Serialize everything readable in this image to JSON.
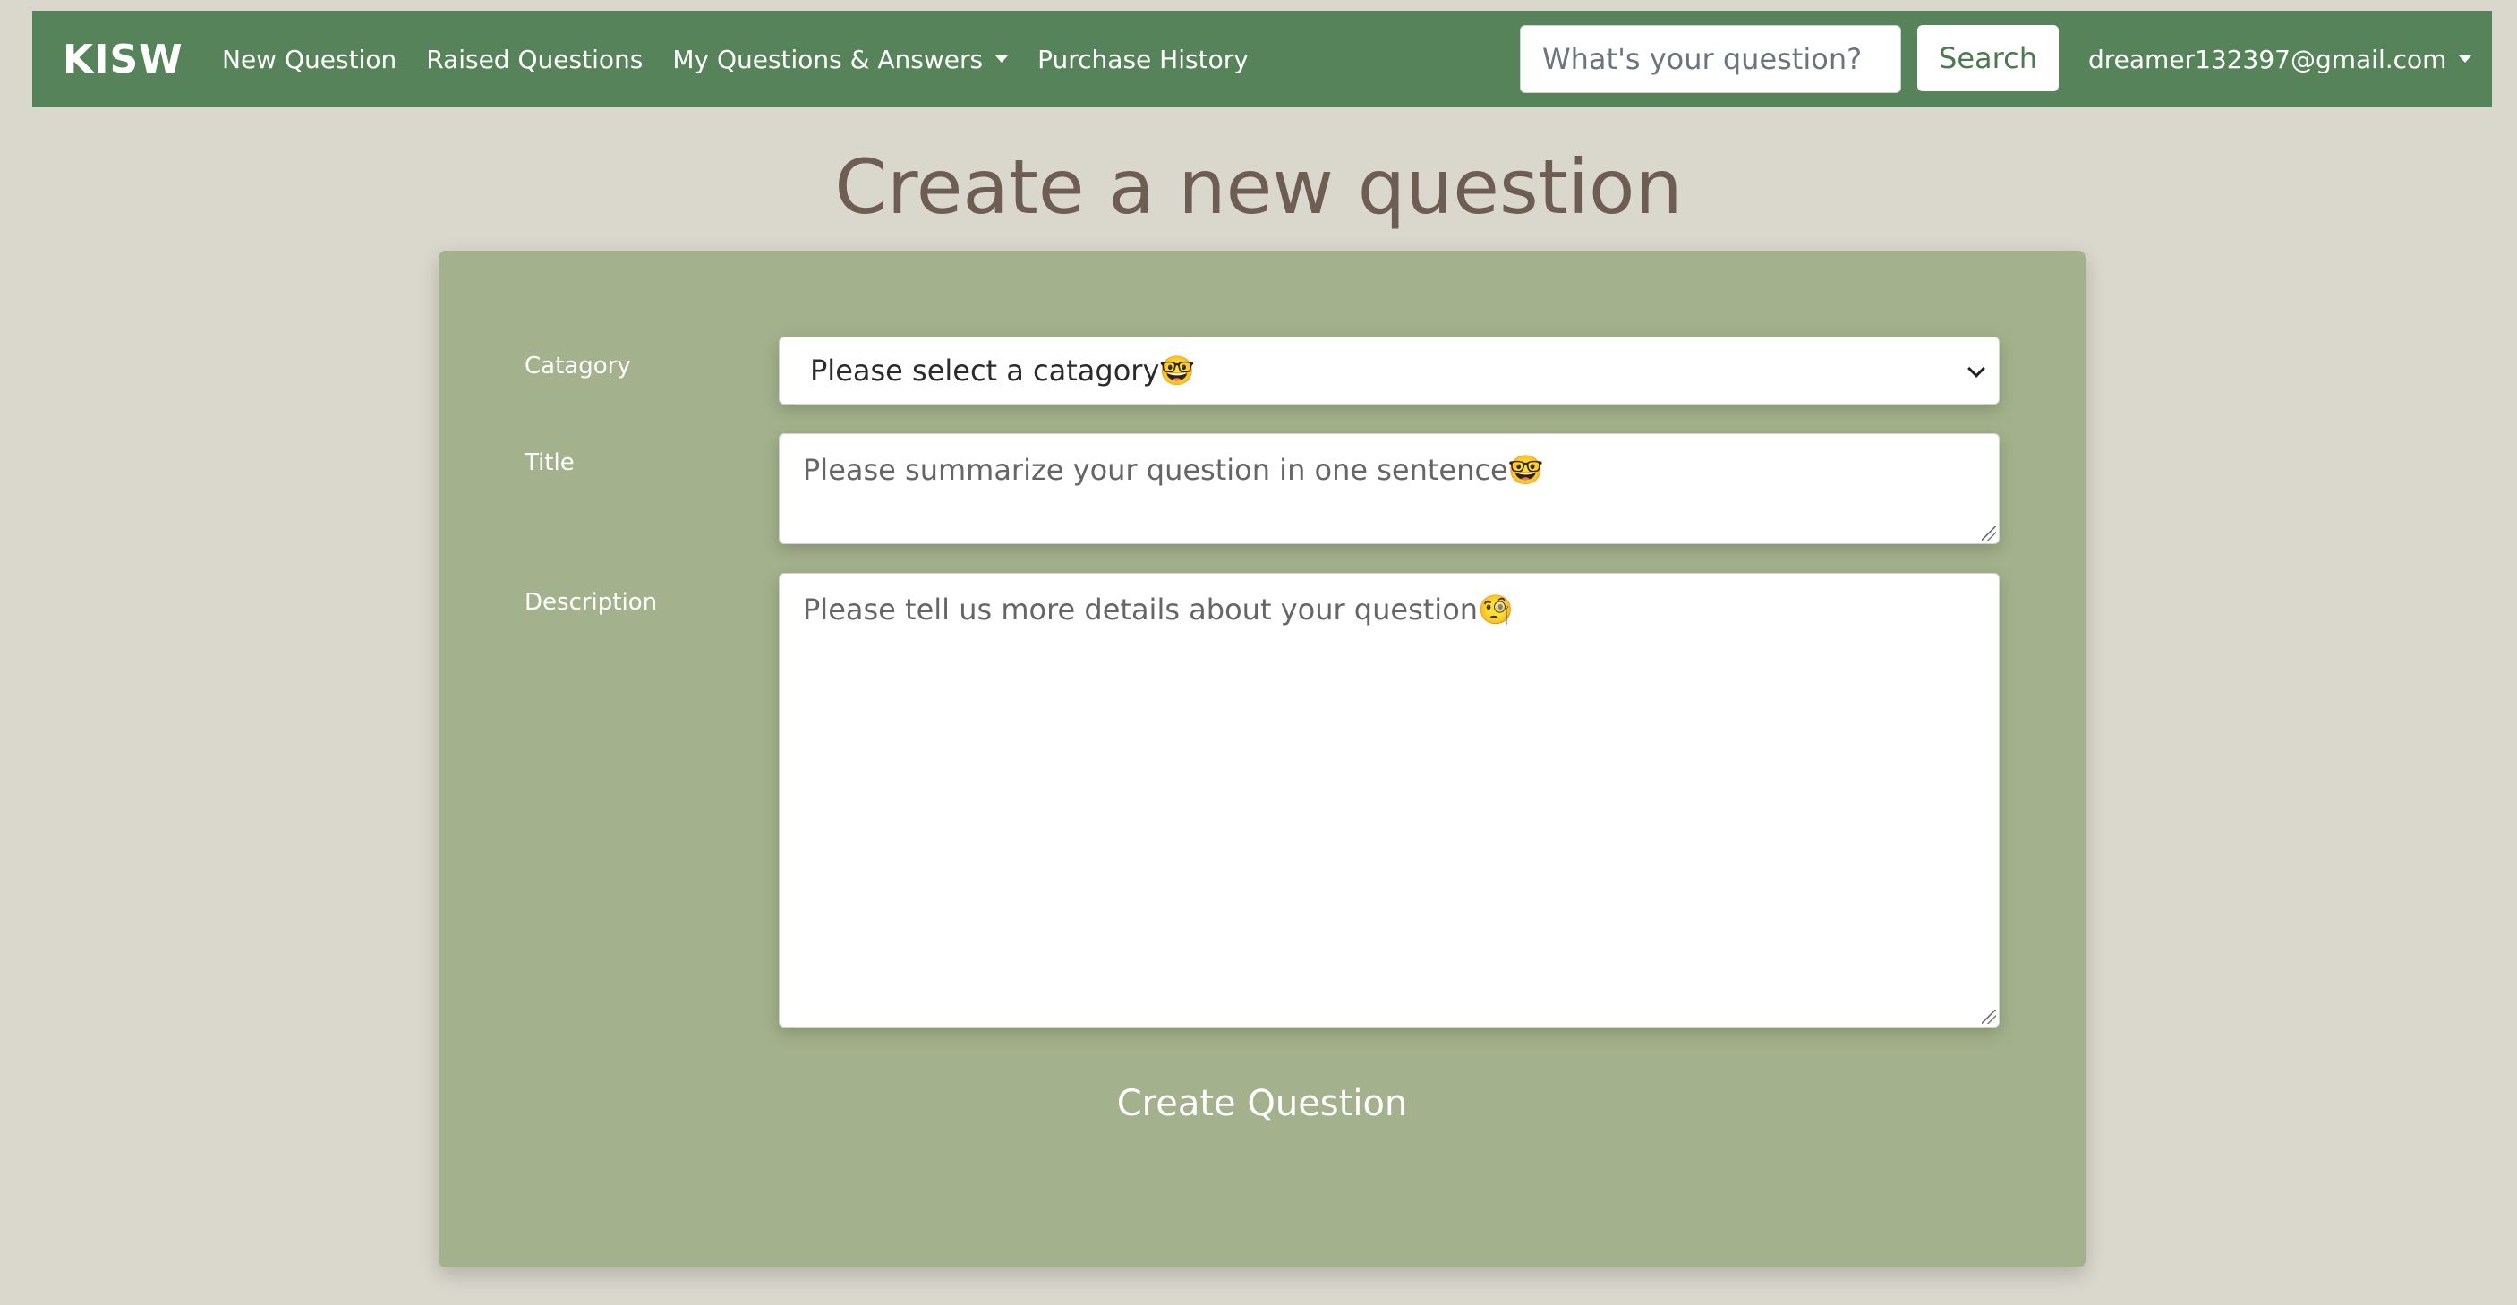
{
  "navbar": {
    "brand": "KISW",
    "links": [
      {
        "label": "New Question"
      },
      {
        "label": "Raised Questions"
      },
      {
        "label": "My Questions & Answers",
        "dropdown": true
      },
      {
        "label": "Purchase History"
      }
    ],
    "search": {
      "placeholder": "What's your question?",
      "button_label": "Search"
    },
    "user_email": "dreamer132397@gmail.com"
  },
  "page": {
    "title": "Create a new question"
  },
  "form": {
    "category": {
      "label": "Catagory",
      "selected": "Please select a catagory🤓"
    },
    "title": {
      "label": "Title",
      "placeholder": "Please summarize your question in one sentence🤓"
    },
    "description": {
      "label": "Description",
      "placeholder": "Please tell us more details about your question🧐"
    },
    "submit_label": "Create Question"
  },
  "colors": {
    "navbar_bg": "#57835a",
    "page_bg": "#dad8cd",
    "card_bg": "#a3b18c",
    "title_color": "#6e5d52",
    "search_button_text": "#4b7a50"
  }
}
